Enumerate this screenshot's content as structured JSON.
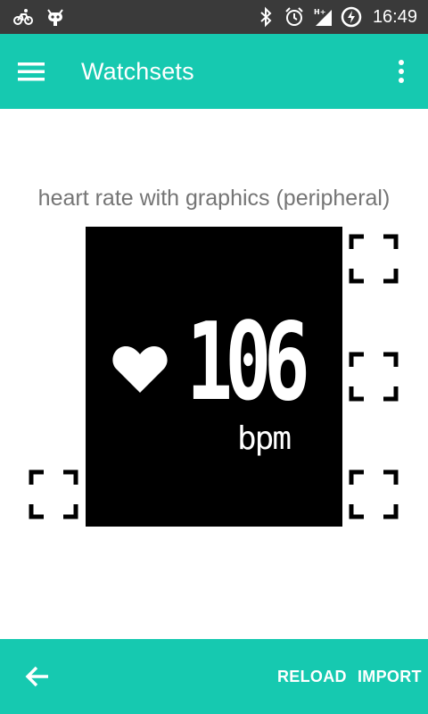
{
  "status_bar": {
    "time": "16:49",
    "icons_left": [
      "bike-icon",
      "android-robot-icon"
    ],
    "icons_right": [
      "bluetooth-icon",
      "alarm-icon",
      "signal-hplus-icon",
      "battery-charging-icon"
    ]
  },
  "app_bar": {
    "title": "Watchsets",
    "menu_icon": "hamburger-menu-icon",
    "overflow_icon": "more-vert-icon"
  },
  "watchset": {
    "name": "heart rate with graphics (peripheral)",
    "heart_rate_value": "106",
    "unit": "bpm"
  },
  "bottom_bar": {
    "back_icon": "arrow-back-icon",
    "reload_label": "RELOAD",
    "import_label": "IMPORT"
  },
  "colors": {
    "primary": "#16c9b0",
    "status_bar": "#3a3a3a",
    "watch_background": "#000000",
    "watch_foreground": "#ffffff",
    "label_gray": "#757575"
  }
}
